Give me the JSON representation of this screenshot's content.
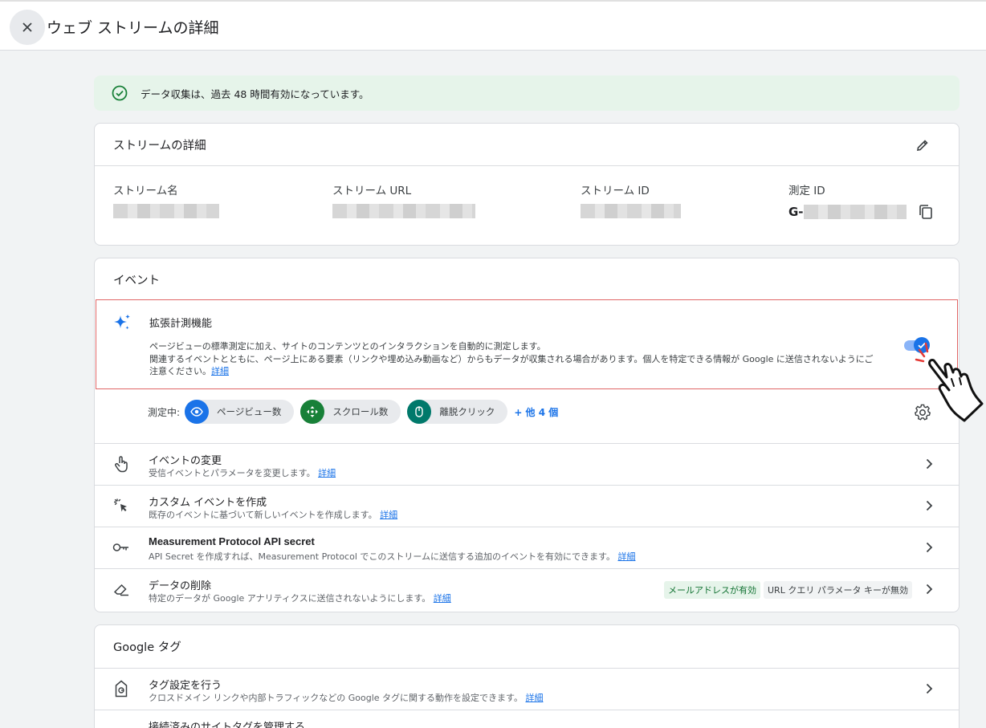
{
  "header": {
    "title": "ウェブ ストリームの詳細"
  },
  "banner": {
    "text": "データ収集は、過去 48 時間有効になっています。"
  },
  "details": {
    "title": "ストリームの詳細",
    "stream_name_label": "ストリーム名",
    "stream_url_label": "ストリーム URL",
    "stream_id_label": "ストリーム ID",
    "measurement_id_label": "測定 ID",
    "measurement_id_prefix": "G-"
  },
  "events": {
    "title": "イベント",
    "enhanced": {
      "title": "拡張計測機能",
      "desc_line1": "ページビューの標準測定に加え、サイトのコンテンツとのインタラクションを自動的に測定します。",
      "desc_line2": "関連するイベントとともに、ページ上にある要素（リンクや埋め込み動画など）からもデータが収集される場合があります。個人を特定できる情報が Google に送信されないようにご",
      "desc_line3": "注意ください。",
      "link": "詳細",
      "toggle_on": true
    },
    "measuring": {
      "label": "測定中:",
      "chips": [
        "ページビュー数",
        "スクロール数",
        "離脱クリック"
      ],
      "more": "+ 他 4 個"
    },
    "rows": [
      {
        "title": "イベントの変更",
        "sub": "受信イベントとパラメータを変更します。",
        "link": "詳細"
      },
      {
        "title": "カスタム イベントを作成",
        "sub": "既存のイベントに基づいて新しいイベントを作成します。",
        "link": "詳細"
      },
      {
        "title": "Measurement Protocol API secret",
        "sub": "API Secret を作成すれば、Measurement Protocol でこのストリームに送信する追加のイベントを有効にできます。",
        "link": "詳細"
      },
      {
        "title": "データの削除",
        "sub": "特定のデータが Google アナリティクスに送信されないようにします。",
        "link": "詳細",
        "badges": [
          "メールアドレスが有効",
          "URL クエリ パラメータ キーが無効"
        ]
      }
    ]
  },
  "gtag": {
    "title": "Google タグ",
    "rows": [
      {
        "title": "タグ設定を行う",
        "sub": "クロスドメイン リンクや内部トラフィックなどの Google タグに関する動作を設定できます。",
        "link": "詳細"
      },
      {
        "title": "接続済みのサイトタグを管理する"
      }
    ]
  },
  "colors": {
    "accent": "#1a73e8",
    "success_bg": "#e6f4ea",
    "highlight_border": "#e06666"
  }
}
